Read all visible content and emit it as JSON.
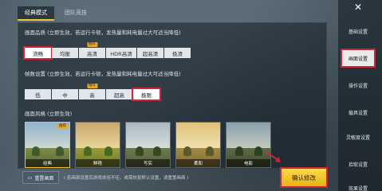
{
  "tabs": [
    {
      "label": "经典模式",
      "active": true
    },
    {
      "label": "团队竞技",
      "active": false
    }
  ],
  "quality": {
    "title": "画面品质 (立即生效，若运行卡顿，发热量和耗电量过大可适当降低)",
    "options": [
      {
        "label": "流畅",
        "selected": true
      },
      {
        "label": "均衡",
        "selected": false
      },
      {
        "label": "高清",
        "selected": false,
        "badge": "推荐"
      },
      {
        "label": "HDR高清",
        "selected": false
      },
      {
        "label": "超高清",
        "selected": false
      },
      {
        "label": "极清",
        "selected": false
      }
    ]
  },
  "framerate": {
    "title": "帧数设置 (立即生效，若运行卡顿，发热量和耗电量过大可适当降低)",
    "options": [
      {
        "label": "低",
        "selected": false
      },
      {
        "label": "中",
        "selected": false
      },
      {
        "label": "高",
        "selected": false,
        "badge": "推荐"
      },
      {
        "label": "超高",
        "selected": false
      },
      {
        "label": "极限",
        "selected": true
      }
    ]
  },
  "style": {
    "title": "画面风格 (立即生效)",
    "options": [
      {
        "label": "经典",
        "selected": true,
        "badge": "推荐"
      },
      {
        "label": "鲜艳",
        "selected": false
      },
      {
        "label": "写实",
        "selected": false
      },
      {
        "label": "柔和",
        "selected": false
      },
      {
        "label": "电影",
        "selected": false
      }
    ]
  },
  "bottom": {
    "reset_label": "重置画面",
    "notice": "( 若画面设置后游戏体验不佳，或需恢复默认设置，请重置画面 )",
    "confirm_label": "确认修改"
  },
  "sidebar": {
    "close_label": "✕",
    "items": [
      {
        "label": "基础设置",
        "active": false
      },
      {
        "label": "画面设置",
        "active": true
      },
      {
        "label": "操作设置",
        "active": false
      },
      {
        "label": "载具设置",
        "active": false
      },
      {
        "label": "灵敏度设置",
        "active": false
      },
      {
        "label": "拾取设置",
        "active": false
      },
      {
        "label": "效果设置",
        "active": false
      }
    ]
  },
  "colors": {
    "highlight_red": "#d0243a",
    "accent_yellow": "#f1c232"
  }
}
